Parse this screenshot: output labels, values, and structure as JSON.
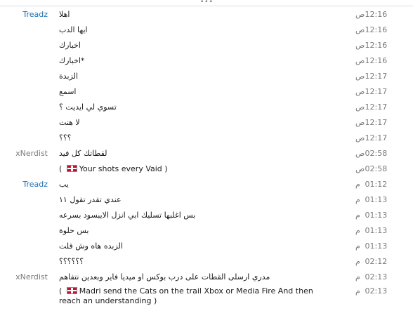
{
  "grip": "•••",
  "messages": [
    {
      "sender": "Treadz",
      "text": "اهلا",
      "ampm": "ص",
      "time": "12:16"
    },
    {
      "sender": "",
      "text": "ايها الدب",
      "ampm": "ص",
      "time": "12:16"
    },
    {
      "sender": "",
      "text": "اخبارك",
      "ampm": "ص",
      "time": "12:16"
    },
    {
      "sender": "",
      "text": "*اخبارك",
      "ampm": "ص",
      "time": "12:16"
    },
    {
      "sender": "",
      "text": "الزبدة",
      "ampm": "ص",
      "time": "12:17"
    },
    {
      "sender": "",
      "text": "اسمع",
      "ampm": "ص",
      "time": "12:17"
    },
    {
      "sender": "",
      "text": "تسوي لي ايديت ؟",
      "ampm": "ص",
      "time": "12:17"
    },
    {
      "sender": "",
      "text": "لا هنت",
      "ampm": "ص",
      "time": "12:17"
    },
    {
      "sender": "",
      "text": "؟؟؟",
      "ampm": "ص",
      "time": "12:17"
    },
    {
      "sender": "xNerdist",
      "text": "لقطاتك كل فيد",
      "ampm": "ص",
      "time": "02:58"
    },
    {
      "sender": "",
      "text_open": "(",
      "text_en": "Your shots every Vaid )",
      "ampm": "ص",
      "time": "02:58"
    },
    {
      "sender": "Treadz",
      "text": "يب",
      "ampm": "م",
      "time": "01:12"
    },
    {
      "sender": "",
      "text": "عندي تقدر تقول ١١",
      "ampm": "م",
      "time": "01:13"
    },
    {
      "sender": "",
      "text": "بس اغلبها تسليك ابي انزل الايبسود بسرعه",
      "ampm": "م",
      "time": "01:13"
    },
    {
      "sender": "",
      "text": "بس حلوة",
      "ampm": "م",
      "time": "01:13"
    },
    {
      "sender": "",
      "text": "الزبده هاه وش قلت",
      "ampm": "م",
      "time": "01:13"
    },
    {
      "sender": "",
      "text": "؟؟؟؟؟؟",
      "ampm": "م",
      "time": "02:12"
    },
    {
      "sender": "xNerdist",
      "text": "مدري ارسلى القطات على درب بوكس او ميديا فاير وبعدين نتفاهم",
      "ampm": "م",
      "time": "02:13"
    },
    {
      "sender": "",
      "text_open": "(",
      "text_en": "Madri send the Cats on the trail Xbox or Media Fire And then reach an understanding )",
      "ampm": "م",
      "time": "02:13"
    }
  ]
}
